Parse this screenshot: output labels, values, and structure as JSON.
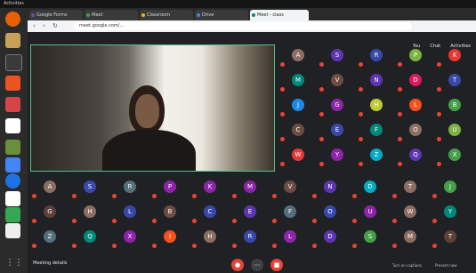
{
  "os_topbar": {
    "left": "Activities",
    "right": ""
  },
  "browser": {
    "tabs": [
      {
        "label": "Google Forms",
        "color": "#7248b9"
      },
      {
        "label": "Meet",
        "color": "#34a853"
      },
      {
        "label": "Classroom",
        "color": "#f4b400"
      },
      {
        "label": "Drive",
        "color": "#4285f4"
      },
      {
        "label": "Meet - class",
        "color": "#00897b"
      }
    ],
    "url": "meet.google.com/..."
  },
  "meeting": {
    "presenter_name": "",
    "top_right": [
      "You",
      "Chat",
      "Activities"
    ],
    "bottom_left": "Meeting details",
    "bottom_right": [
      "Turn on captions",
      "Present now"
    ],
    "participants": [
      {
        "i": "A",
        "c": "#8d6e63",
        "n": ""
      },
      {
        "i": "S",
        "c": "#5e35b1",
        "n": ""
      },
      {
        "i": "R",
        "c": "#3949ab",
        "n": ""
      },
      {
        "i": "P",
        "c": "#7cb342",
        "n": ""
      },
      {
        "i": "K",
        "c": "#e53935",
        "n": ""
      },
      {
        "i": "M",
        "c": "#00897b",
        "n": ""
      },
      {
        "i": "V",
        "c": "#6d4c41",
        "n": ""
      },
      {
        "i": "N",
        "c": "#5e35b1",
        "n": ""
      },
      {
        "i": "D",
        "c": "#d81b60",
        "n": ""
      },
      {
        "i": "T",
        "c": "#3949ab",
        "n": ""
      },
      {
        "i": "J",
        "c": "#1e88e5",
        "n": ""
      },
      {
        "i": "G",
        "c": "#8e24aa",
        "n": ""
      },
      {
        "i": "H",
        "c": "#c0ca33",
        "n": ""
      },
      {
        "i": "L",
        "c": "#f4511e",
        "n": ""
      },
      {
        "i": "B",
        "c": "#43a047",
        "n": ""
      },
      {
        "i": "C",
        "c": "#6d4c41",
        "n": ""
      },
      {
        "i": "E",
        "c": "#3949ab",
        "n": ""
      },
      {
        "i": "F",
        "c": "#00897b",
        "n": ""
      },
      {
        "i": "O",
        "c": "#8d6e63",
        "n": ""
      },
      {
        "i": "U",
        "c": "#7cb342",
        "n": ""
      },
      {
        "i": "W",
        "c": "#e53935",
        "n": ""
      },
      {
        "i": "Y",
        "c": "#8e24aa",
        "n": ""
      },
      {
        "i": "Z",
        "c": "#00acc1",
        "n": ""
      },
      {
        "i": "Q",
        "c": "#5e35b1",
        "n": ""
      },
      {
        "i": "X",
        "c": "#43a047",
        "n": ""
      }
    ],
    "bottom_participants": [
      {
        "i": "A",
        "c": "#8d6e63"
      },
      {
        "i": "S",
        "c": "#3949ab"
      },
      {
        "i": "R",
        "c": "#546e7a"
      },
      {
        "i": "P",
        "c": "#8e24aa"
      },
      {
        "i": "K",
        "c": "#8e24aa"
      },
      {
        "i": "M",
        "c": "#8e24aa"
      },
      {
        "i": "V",
        "c": "#6d4c41"
      },
      {
        "i": "N",
        "c": "#5e35b1"
      },
      {
        "i": "D",
        "c": "#00acc1"
      },
      {
        "i": "T",
        "c": "#8d6e63"
      },
      {
        "i": "J",
        "c": "#43a047"
      },
      {
        "i": "G",
        "c": "#5d4037"
      },
      {
        "i": "H",
        "c": "#8d6e63"
      },
      {
        "i": "L",
        "c": "#3949ab"
      },
      {
        "i": "B",
        "c": "#6d4c41"
      },
      {
        "i": "C",
        "c": "#3949ab"
      },
      {
        "i": "E",
        "c": "#5e35b1"
      },
      {
        "i": "F",
        "c": "#546e7a"
      },
      {
        "i": "O",
        "c": "#3949ab"
      },
      {
        "i": "U",
        "c": "#8e24aa"
      },
      {
        "i": "W",
        "c": "#8d6e63"
      },
      {
        "i": "Y",
        "c": "#00897b"
      },
      {
        "i": "Z",
        "c": "#546e7a"
      },
      {
        "i": "Q",
        "c": "#00897b"
      },
      {
        "i": "X",
        "c": "#8e24aa"
      },
      {
        "i": "I",
        "c": "#f4511e"
      },
      {
        "i": "H",
        "c": "#8d6e63"
      },
      {
        "i": "R",
        "c": "#3949ab"
      },
      {
        "i": "L",
        "c": "#8e24aa"
      },
      {
        "i": "D",
        "c": "#5e35b1"
      },
      {
        "i": "S",
        "c": "#43a047"
      },
      {
        "i": "M",
        "c": "#8d6e63"
      },
      {
        "i": "T",
        "c": "#5d4037"
      }
    ]
  },
  "dock": [
    "firefox-icon",
    "files-icon",
    "terminal-icon",
    "software-icon",
    "chrome-icon",
    "docs-icon",
    "calendar-icon",
    "settings-icon",
    "app-icon",
    "app-icon",
    "apps-grid-icon"
  ]
}
